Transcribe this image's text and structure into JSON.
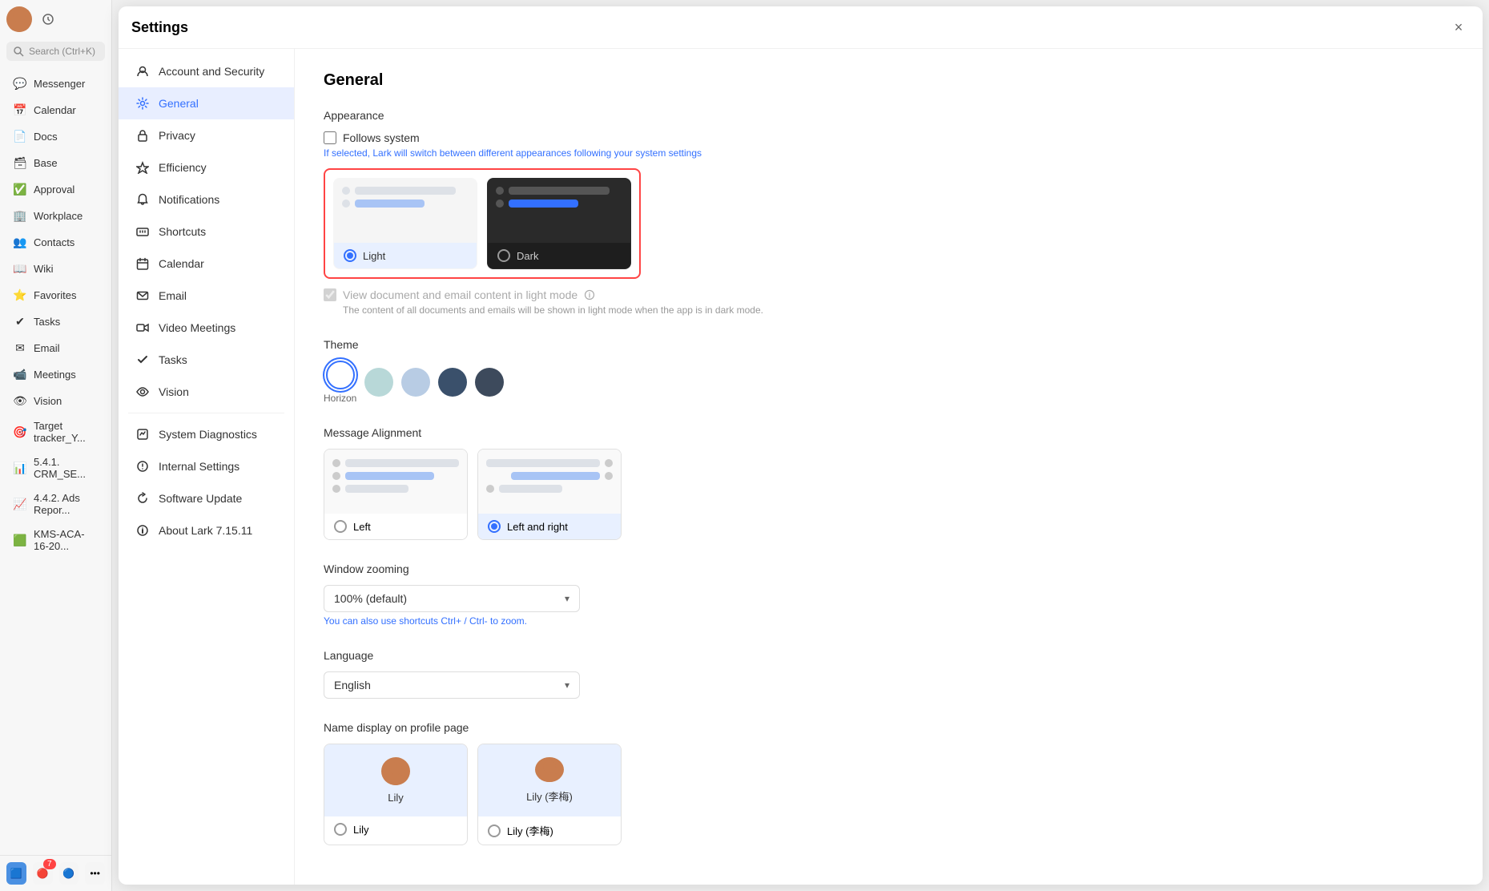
{
  "app": {
    "title": "Settings",
    "close_label": "×"
  },
  "sidebar": {
    "search_placeholder": "Search (Ctrl+K)",
    "nav_items": [
      {
        "id": "messenger",
        "label": "Messenger",
        "icon": "💬"
      },
      {
        "id": "calendar",
        "label": "Calendar",
        "icon": "📅"
      },
      {
        "id": "docs",
        "label": "Docs",
        "icon": "📄"
      },
      {
        "id": "base",
        "label": "Base",
        "icon": "🗃"
      },
      {
        "id": "approval",
        "label": "Approval",
        "icon": "✅"
      },
      {
        "id": "workplace",
        "label": "Workplace",
        "icon": "🏢"
      },
      {
        "id": "contacts",
        "label": "Contacts",
        "icon": "👥"
      },
      {
        "id": "wiki",
        "label": "Wiki",
        "icon": "📖"
      },
      {
        "id": "favorites",
        "label": "Favorites",
        "icon": "⭐"
      },
      {
        "id": "tasks",
        "label": "Tasks",
        "icon": "✔"
      },
      {
        "id": "email",
        "label": "Email",
        "icon": "✉"
      },
      {
        "id": "meetings",
        "label": "Meetings",
        "icon": "📹"
      },
      {
        "id": "vision",
        "label": "Vision",
        "icon": "👁"
      },
      {
        "id": "target",
        "label": "Target tracker_Y...",
        "icon": "🎯"
      },
      {
        "id": "crm",
        "label": "5.4.1. CRM_SE...",
        "icon": "📊"
      },
      {
        "id": "ads",
        "label": "4.4.2. Ads Repor...",
        "icon": "📈"
      },
      {
        "id": "kms",
        "label": "KMS-ACA-16-20...",
        "icon": "🟩"
      }
    ],
    "bottom_icons": [
      "🟦",
      "🔴",
      "🔵",
      "⚫"
    ]
  },
  "settings_nav": {
    "items": [
      {
        "id": "account",
        "label": "Account and Security",
        "icon": "person",
        "active": false
      },
      {
        "id": "general",
        "label": "General",
        "icon": "gear",
        "active": true
      },
      {
        "id": "privacy",
        "label": "Privacy",
        "icon": "lock",
        "active": false
      },
      {
        "id": "efficiency",
        "label": "Efficiency",
        "icon": "lightning",
        "active": false
      },
      {
        "id": "notifications",
        "label": "Notifications",
        "icon": "bell",
        "active": false
      },
      {
        "id": "shortcuts",
        "label": "Shortcuts",
        "icon": "keyboard",
        "active": false
      },
      {
        "id": "calendar",
        "label": "Calendar",
        "icon": "calendar",
        "active": false
      },
      {
        "id": "email",
        "label": "Email",
        "icon": "email",
        "active": false
      },
      {
        "id": "video",
        "label": "Video Meetings",
        "icon": "video",
        "active": false
      },
      {
        "id": "tasks",
        "label": "Tasks",
        "icon": "tasks",
        "active": false
      },
      {
        "id": "vision",
        "label": "Vision",
        "icon": "vision",
        "active": false
      },
      {
        "id": "diagnostics",
        "label": "System Diagnostics",
        "icon": "diagnostics",
        "active": false
      },
      {
        "id": "internal",
        "label": "Internal Settings",
        "icon": "internal",
        "active": false
      },
      {
        "id": "update",
        "label": "Software Update",
        "icon": "update",
        "active": false
      },
      {
        "id": "about",
        "label": "About Lark 7.15.11",
        "icon": "info",
        "active": false
      }
    ]
  },
  "general": {
    "title": "General",
    "appearance": {
      "label": "Appearance",
      "follows_system_label": "Follows system",
      "follows_system_hint": "If selected, Lark will switch between different appearances following your system settings",
      "light_label": "Light",
      "dark_label": "Dark",
      "view_doc_label": "View document and email content in light mode",
      "view_doc_hint": "The content of all documents and emails will be shown in light mode when the app is in dark mode."
    },
    "theme": {
      "label": "Theme",
      "colors": [
        "#ffffff",
        "#b8d8d8",
        "#b8cce4",
        "#3a506b",
        "#3d4a5c"
      ],
      "selected_index": 0,
      "labels": [
        "Horizon",
        "",
        "",
        "",
        ""
      ]
    },
    "message_alignment": {
      "label": "Message Alignment",
      "left_label": "Left",
      "left_right_label": "Left and right",
      "selected": "left_right"
    },
    "window_zooming": {
      "label": "Window zooming",
      "value": "100% (default)",
      "hint": "You can also use shortcuts Ctrl+ / Ctrl- to zoom."
    },
    "language": {
      "label": "Language",
      "value": "English"
    },
    "name_display": {
      "label": "Name display on profile page",
      "option1": "Lily",
      "option2": "Lily (李梅)"
    }
  }
}
